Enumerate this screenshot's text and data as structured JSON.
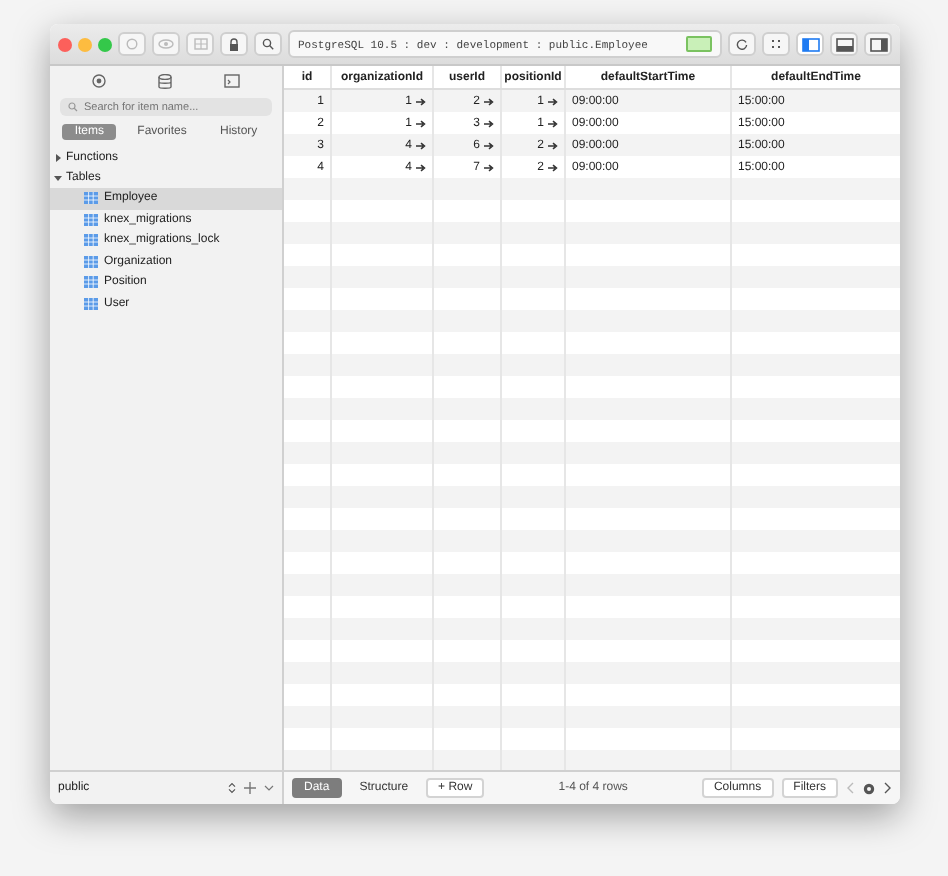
{
  "toolbar": {
    "connection": "PostgreSQL 10.5 : dev : development : public.Employee",
    "layouts": [
      {
        "selected": true
      },
      {
        "selected": false
      },
      {
        "selected": false
      }
    ]
  },
  "sidebar": {
    "search": {
      "placeholder": "Search for item name..."
    },
    "tabs": [
      {
        "label": "Items",
        "selected": true
      },
      {
        "label": "Favorites",
        "selected": false
      },
      {
        "label": "History",
        "selected": false
      }
    ],
    "tree": [
      {
        "label": "Functions",
        "expanded": false
      },
      {
        "label": "Tables",
        "expanded": true,
        "children": [
          {
            "label": "Employee",
            "selected": true
          },
          {
            "label": "knex_migrations",
            "selected": false
          },
          {
            "label": "knex_migrations_lock",
            "selected": false
          },
          {
            "label": "Organization",
            "selected": false
          },
          {
            "label": "Position",
            "selected": false
          },
          {
            "label": "User",
            "selected": false
          }
        ]
      }
    ],
    "schema": "public"
  },
  "table": {
    "columns": [
      "id",
      "organizationId",
      "userId",
      "positionId",
      "defaultStartTime",
      "defaultEndTime"
    ],
    "rows": [
      [
        {
          "text": "1",
          "link": false
        },
        {
          "text": "1",
          "link": true
        },
        {
          "text": "2",
          "link": true
        },
        {
          "text": "1",
          "link": true
        },
        {
          "text": "09:00:00",
          "link": false
        },
        {
          "text": "15:00:00",
          "link": false
        }
      ],
      [
        {
          "text": "2",
          "link": false
        },
        {
          "text": "1",
          "link": true
        },
        {
          "text": "3",
          "link": true
        },
        {
          "text": "1",
          "link": true
        },
        {
          "text": "09:00:00",
          "link": false
        },
        {
          "text": "15:00:00",
          "link": false
        }
      ],
      [
        {
          "text": "3",
          "link": false
        },
        {
          "text": "4",
          "link": true
        },
        {
          "text": "6",
          "link": true
        },
        {
          "text": "2",
          "link": true
        },
        {
          "text": "09:00:00",
          "link": false
        },
        {
          "text": "15:00:00",
          "link": false
        }
      ],
      [
        {
          "text": "4",
          "link": false
        },
        {
          "text": "4",
          "link": true
        },
        {
          "text": "7",
          "link": true
        },
        {
          "text": "2",
          "link": true
        },
        {
          "text": "09:00:00",
          "link": false
        },
        {
          "text": "15:00:00",
          "link": false
        }
      ]
    ]
  },
  "footer": {
    "tabs": [
      {
        "label": "Data",
        "selected": true
      },
      {
        "label": "Structure",
        "selected": false
      }
    ],
    "add_row": "+ Row",
    "count": "1-4 of 4 rows",
    "buttons": [
      "Columns",
      "Filters"
    ]
  }
}
